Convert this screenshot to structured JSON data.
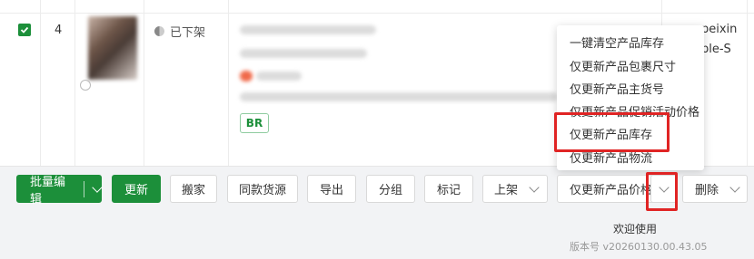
{
  "row": {
    "index": "4",
    "status": "已下架",
    "tag": "BR",
    "right_line1": "peixin",
    "right_line2": "ple-S"
  },
  "toolbar": {
    "batch_edit": "批量编辑",
    "update": "更新",
    "move": "搬家",
    "same_source": "同款货源",
    "export": "导出",
    "group": "分组",
    "mark": "标记",
    "listing": "上架",
    "update_price": "仅更新产品价格",
    "delete": "删除"
  },
  "menu": {
    "items": [
      "一键清空产品库存",
      "仅更新产品包裹尺寸",
      "仅更新产品主货号",
      "仅更新产品促销活动价格",
      "仅更新产品库存",
      "仅更新产品物流"
    ]
  },
  "footer": {
    "welcome": "欢迎使用",
    "version": "版本号 v20260130.00.43.05"
  },
  "colors": {
    "primary": "#1c8f3a",
    "highlight": "#e02424"
  }
}
